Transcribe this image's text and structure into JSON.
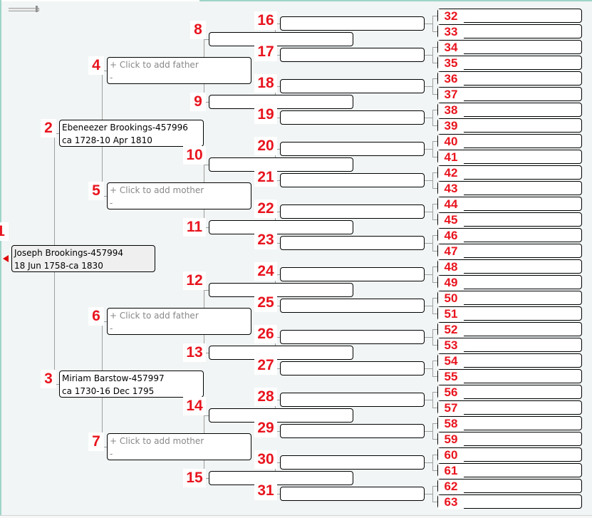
{
  "placeholders": {
    "add_father": "+ Click to add father",
    "add_mother": "+ Click to add mother",
    "dash": "-"
  },
  "colors": {
    "label": "#e8141e",
    "root_box": "#efefef",
    "background": "#f1f5f5",
    "connector": "#a0a0a0"
  },
  "icons": {
    "navigate_left": "red-left-triangle",
    "zoom": "zoom-slider"
  },
  "persons": [
    {
      "num": "1",
      "name": "Joseph Brookings-457994",
      "dates": "18 Jun 1758-ca 1830"
    },
    {
      "num": "2",
      "name": "Ebeneezer Brookings-457996",
      "dates": "ca 1728-10 Apr 1810"
    },
    {
      "num": "3",
      "name": "Miriam Barstow-457997",
      "dates": "ca 1730-16 Dec 1795"
    },
    {
      "num": "4",
      "name": "+ Click to add father",
      "dates": "-",
      "placeholder": true
    },
    {
      "num": "5",
      "name": "+ Click to add mother",
      "dates": "-",
      "placeholder": true
    },
    {
      "num": "6",
      "name": "+ Click to add father",
      "dates": "-",
      "placeholder": true
    },
    {
      "num": "7",
      "name": "+ Click to add mother",
      "dates": "-",
      "placeholder": true
    }
  ],
  "empty_slots_from": 8,
  "empty_slots_to": 63
}
